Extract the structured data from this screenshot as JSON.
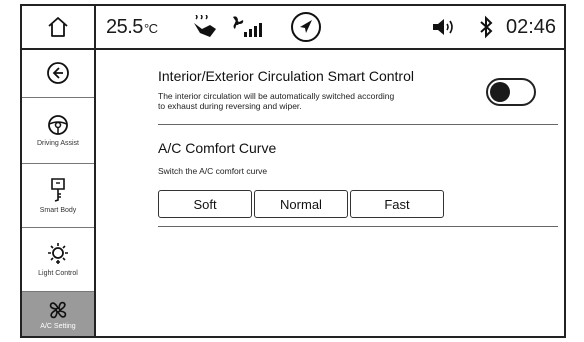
{
  "status": {
    "temperature": "25.5",
    "temp_unit": "°C",
    "time": "02:46",
    "icons": [
      "home-icon",
      "seat-heater-icon",
      "fan-level-icon",
      "navigation-icon",
      "volume-icon",
      "bluetooth-icon"
    ]
  },
  "sidebar": {
    "items": [
      {
        "label": "",
        "icon": "back-icon"
      },
      {
        "label": "Driving Assist",
        "icon": "steering-wheel-icon"
      },
      {
        "label": "Smart Body",
        "icon": "key-icon"
      },
      {
        "label": "Light Control",
        "icon": "light-icon"
      },
      {
        "label": "A/C Setting",
        "icon": "fan-icon",
        "selected": true
      }
    ]
  },
  "circulation": {
    "title": "Interior/Exterior Circulation Smart Control",
    "description_line1": "The interior circulation will be automatically switched according",
    "description_line2": "to exhaust during reversing and wiper.",
    "toggle_on": false
  },
  "comfort": {
    "title": "A/C Comfort Curve",
    "description": "Switch the A/C comfort curve",
    "options": [
      "Soft",
      "Normal",
      "Fast"
    ]
  },
  "colors": {
    "selected_background": "#9a9a9a",
    "border": "#222222"
  }
}
